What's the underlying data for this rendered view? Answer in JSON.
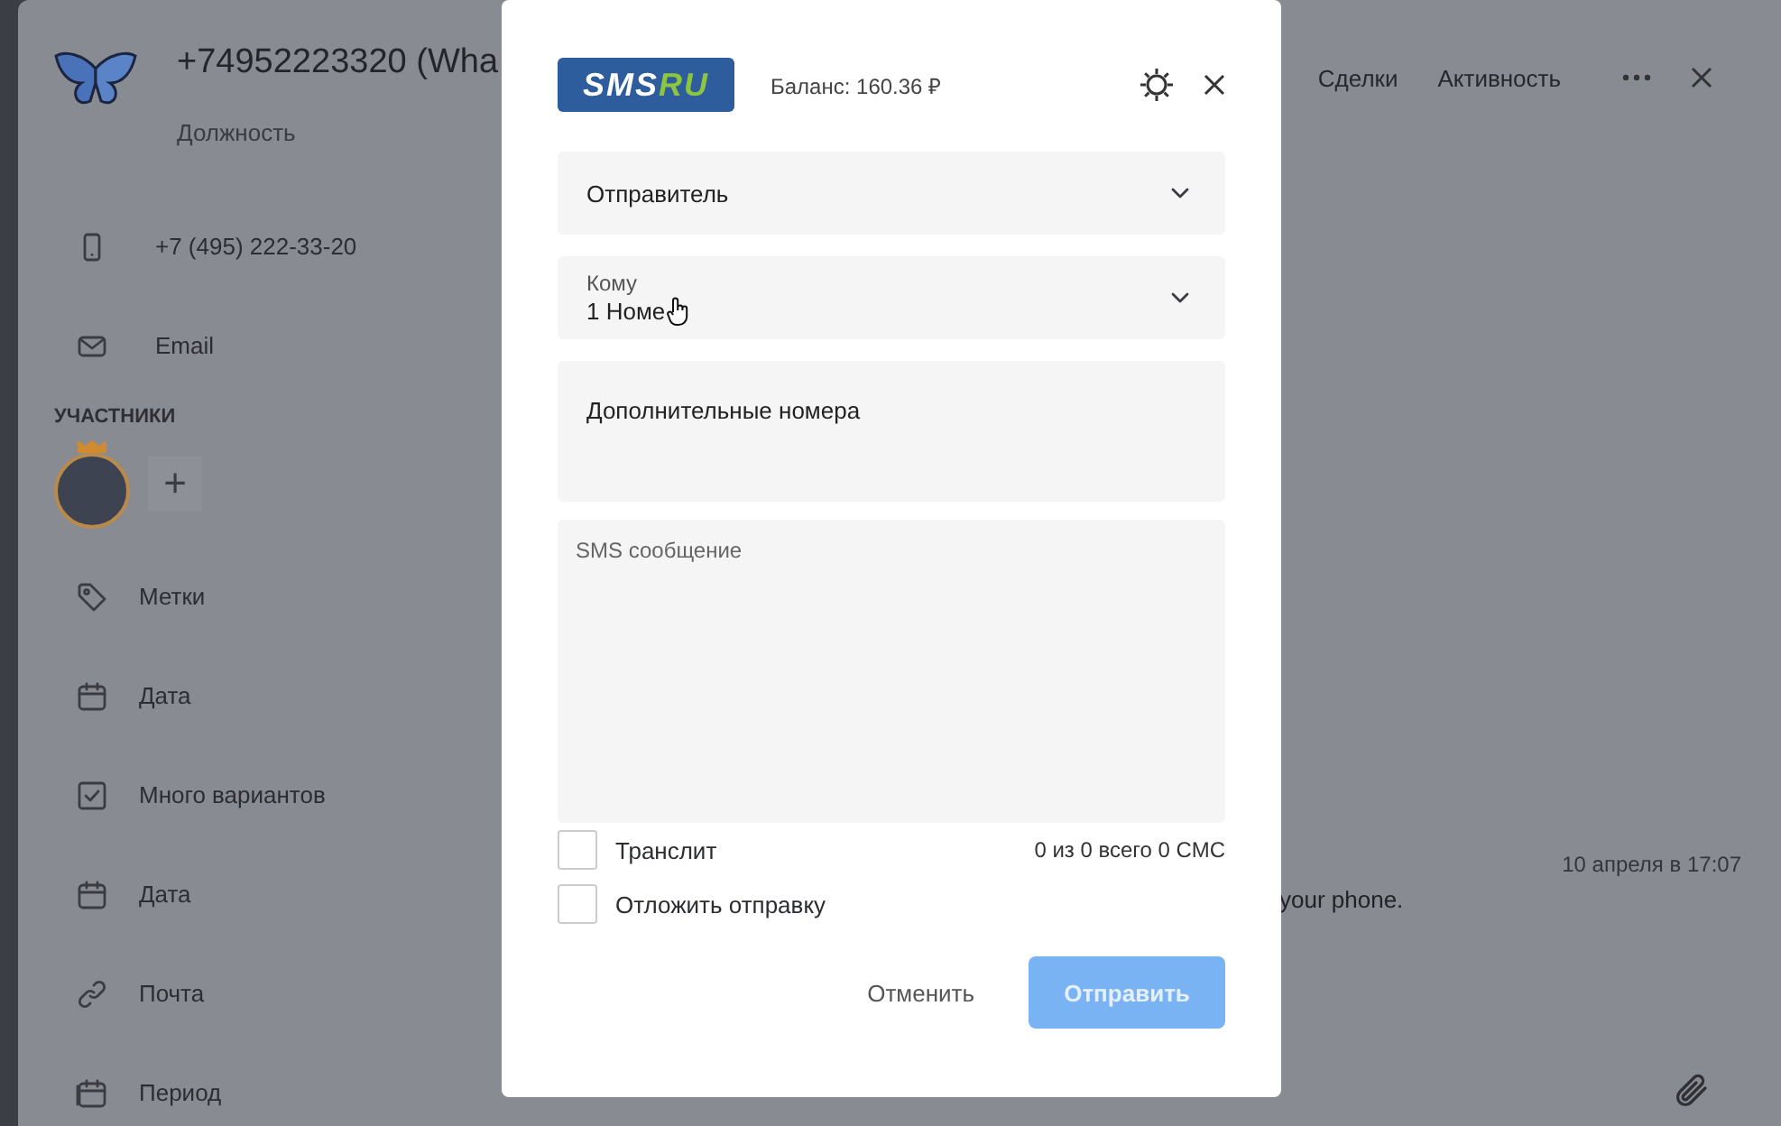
{
  "contact": {
    "title": "+74952223320 (Wha",
    "subtitle": "Должность",
    "phone": "+7 (495) 222-33-20",
    "email": "Email"
  },
  "participants": {
    "heading": "УЧАСТНИКИ",
    "add": "+"
  },
  "fields": [
    {
      "kind": "tag",
      "label": "Метки"
    },
    {
      "kind": "date",
      "label": "Дата"
    },
    {
      "kind": "multi",
      "label": "Много вариантов"
    },
    {
      "kind": "date",
      "label": "Дата"
    },
    {
      "kind": "link",
      "label": "Почта"
    },
    {
      "kind": "period",
      "label": "Период"
    }
  ],
  "tabs": [
    {
      "label": "Сделки"
    },
    {
      "label": "Активность"
    }
  ],
  "message": {
    "time": "10 апреля в 17:07",
    "text": "your phone."
  },
  "modal": {
    "logo": [
      "SMS",
      "RU"
    ],
    "balance": "Баланс: 160.36 ₽",
    "sender": {
      "label": "Отправитель"
    },
    "recipient": {
      "label": "Кому",
      "value": "1 Номе"
    },
    "extra_numbers": {
      "placeholder": "Дополнительные номера"
    },
    "sms": {
      "placeholder": "SMS сообщение"
    },
    "options": [
      {
        "label": "Транслит",
        "checked": false
      },
      {
        "label": "Отложить отправку",
        "checked": false
      }
    ],
    "counter": "0 из 0 всего 0 СМС",
    "cancel": "Отменить",
    "send": {
      "label": "Отправить",
      "disabled": true
    }
  }
}
